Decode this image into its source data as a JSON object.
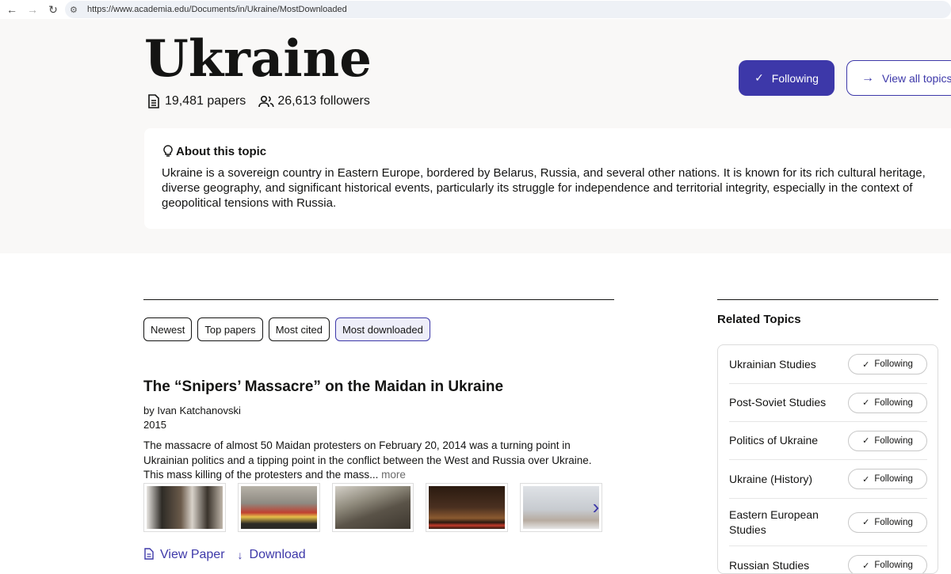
{
  "browser": {
    "url": "https://www.academia.edu/Documents/in/Ukraine/MostDownloaded",
    "back_icon": "arrow-left-icon",
    "forward_icon": "arrow-right-icon",
    "reload_icon": "reload-icon"
  },
  "topic": {
    "title": "Ukraine",
    "papers_count": "19,481 papers",
    "followers_count": "26,613 followers",
    "following_label": "Following",
    "view_all_label": "View all topics"
  },
  "about": {
    "heading": "About this topic",
    "text": "Ukraine is a sovereign country in Eastern Europe, bordered by Belarus, Russia, and several other nations. It is known for its rich cultural heritage, diverse geography, and significant historical events, particularly its struggle for independence and territorial integrity, especially in the context of geopolitical tensions with Russia."
  },
  "filters": [
    {
      "label": "Newest",
      "active": false
    },
    {
      "label": "Top papers",
      "active": false
    },
    {
      "label": "Most cited",
      "active": false
    },
    {
      "label": "Most downloaded",
      "active": true
    }
  ],
  "paper": {
    "title": "The “Snipers’ Massacre” on the Maidan in Ukraine",
    "author": "by Ivan Katchanovski",
    "year": "2015",
    "abstract": "The massacre of almost 50 Maidan protesters on February 20, 2014 was a turning point in Ukrainian politics and a tipping point in the conflict between the West and Russia over Ukraine. This mass killing of the protesters and the mass...",
    "more_label": " more",
    "view_label": "View Paper",
    "download_label": "Download"
  },
  "related": {
    "title": "Related Topics",
    "button_label": "Following",
    "items": [
      {
        "name": "Ukrainian Studies"
      },
      {
        "name": "Post-Soviet Studies"
      },
      {
        "name": "Politics of Ukraine"
      },
      {
        "name": "Ukraine (History)"
      },
      {
        "name": "Eastern European Studies"
      },
      {
        "name": "Russian Studies"
      }
    ]
  },
  "colors": {
    "accent": "#3d38a9",
    "hero_bg": "#f9f8f7",
    "text": "#141413"
  }
}
